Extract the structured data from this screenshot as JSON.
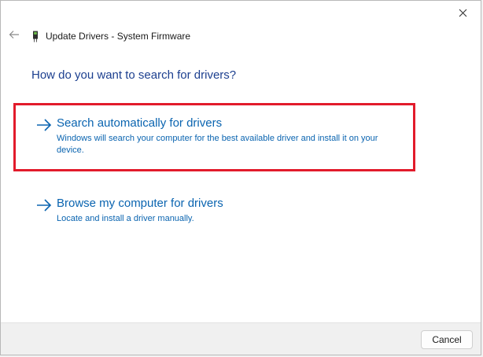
{
  "window": {
    "title": "Update Drivers - System Firmware",
    "close_icon": "close-icon",
    "back_icon": "back-arrow-icon",
    "device_icon": "device-chip-icon"
  },
  "main": {
    "question": "How do you want to search for drivers?",
    "options": [
      {
        "title": "Search automatically for drivers",
        "description": "Windows will search your computer for the best available driver and install it on your device.",
        "icon": "arrow-right-icon",
        "highlighted": true
      },
      {
        "title": "Browse my computer for drivers",
        "description": "Locate and install a driver manually.",
        "icon": "arrow-right-icon",
        "highlighted": false
      }
    ]
  },
  "footer": {
    "cancel_label": "Cancel"
  },
  "colors": {
    "link_blue": "#0a64b0",
    "heading_blue": "#1c3f8f",
    "highlight_red": "#e21b2b"
  }
}
